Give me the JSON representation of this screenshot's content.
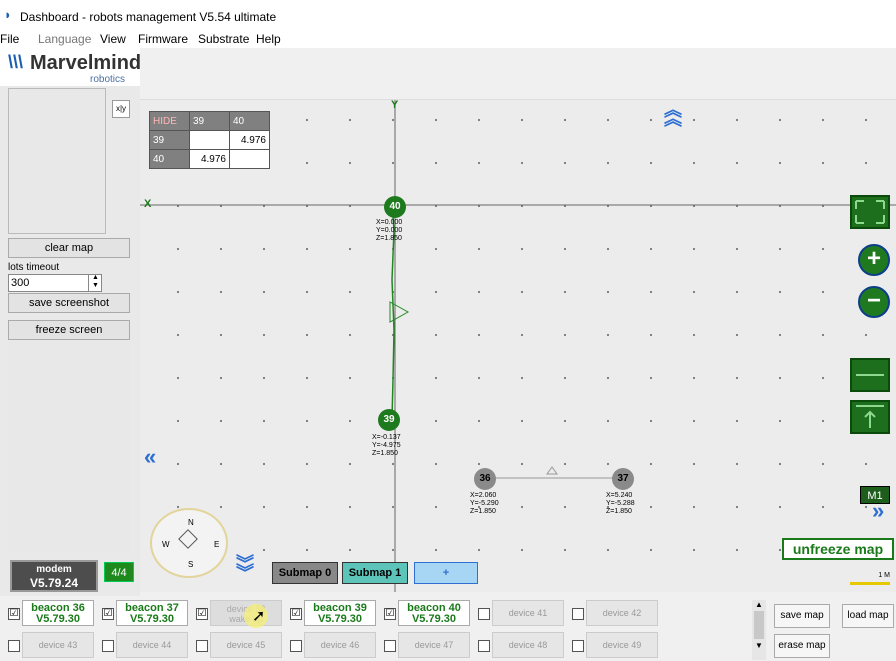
{
  "window": {
    "title": "Dashboard - robots management  V5.54  ultimate"
  },
  "menu": [
    "File",
    "Language",
    "View",
    "Firmware",
    "Substrate",
    "Help"
  ],
  "logo": {
    "name": "Marvelmind",
    "sub": "robotics"
  },
  "left": {
    "xy_label": "x|y",
    "clear_map": "clear map",
    "dots_timeout_label": "lots timeout",
    "dots_timeout_value": "300",
    "save_screenshot": "save screenshot",
    "freeze_screen": "freeze screen"
  },
  "modem": {
    "line1": "modem",
    "line2": "V5.79.24",
    "count": "4/4"
  },
  "distance_table": {
    "header": [
      "HIDE",
      "39",
      "40"
    ],
    "rows": [
      [
        "39",
        "",
        "4.976"
      ],
      [
        "40",
        "4.976",
        ""
      ]
    ]
  },
  "beacons": [
    {
      "id": "40",
      "x": "X=0.000",
      "y": "Y=0.000",
      "z": "Z=1.850"
    },
    {
      "id": "39",
      "x": "X=-0.137",
      "y": "Y=-4.975",
      "z": "Z=1.850"
    },
    {
      "id": "36",
      "x": "X=2.060",
      "y": "Y=-5.290",
      "z": "Z=1.850"
    },
    {
      "id": "37",
      "x": "X=5.240",
      "y": "Y=-5.288",
      "z": "Z=1.850"
    }
  ],
  "axes": {
    "x": "X",
    "y": "Y"
  },
  "compass": {
    "n": "N",
    "s": "S",
    "w": "W",
    "e": "E"
  },
  "submaps": {
    "sub0": "Submap 0",
    "sub1": "Submap 1",
    "add": "+"
  },
  "map": {
    "unfreeze": "unfreeze map",
    "m1": "M1",
    "scale": "1 M"
  },
  "devices_row1": [
    {
      "name": "beacon 36",
      "ver": "V5.79.30",
      "checked": "☑",
      "state": "on"
    },
    {
      "name": "beacon 37",
      "ver": "V5.79.30",
      "checked": "☑",
      "state": "on"
    },
    {
      "name": "device 38",
      "ver": "wake up",
      "checked": "☑",
      "state": "wake"
    },
    {
      "name": "beacon 39",
      "ver": "V5.79.30",
      "checked": "☑",
      "state": "on"
    },
    {
      "name": "beacon 40",
      "ver": "V5.79.30",
      "checked": "☑",
      "state": "on"
    },
    {
      "name": "device 41",
      "ver": "",
      "checked": "",
      "state": "off"
    },
    {
      "name": "device 42",
      "ver": "",
      "checked": "",
      "state": "off"
    }
  ],
  "devices_row2": [
    {
      "name": "device 43",
      "checked": ""
    },
    {
      "name": "device 44",
      "checked": ""
    },
    {
      "name": "device 45",
      "checked": ""
    },
    {
      "name": "device 46",
      "checked": ""
    },
    {
      "name": "device 47",
      "checked": ""
    },
    {
      "name": "device 48",
      "checked": ""
    },
    {
      "name": "device 49",
      "checked": ""
    }
  ],
  "right_buttons": {
    "save_map": "save map",
    "load_map": "load map",
    "erase_map": "erase map"
  },
  "colors": {
    "beacon_green": "#1e7a1e",
    "beacon_gray": "#8a8a8a",
    "accent_green": "#1a7a1a",
    "highlight_yellow": "#f5ef7a"
  }
}
